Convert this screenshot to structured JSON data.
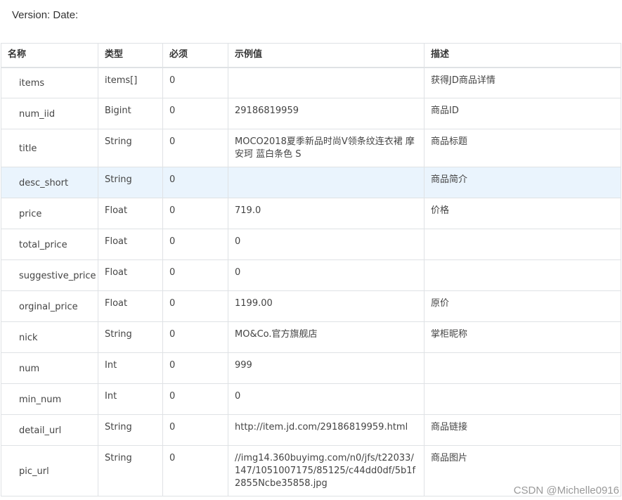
{
  "header": {
    "version_line": "Version: Date:"
  },
  "table": {
    "columns": [
      "名称",
      "类型",
      "必须",
      "示例值",
      "描述"
    ],
    "rows": [
      {
        "name": "items",
        "type": "items[]",
        "required": "0",
        "example": "",
        "desc": "获得JD商品详情"
      },
      {
        "name": "num_iid",
        "type": "Bigint",
        "required": "0",
        "example": "29186819959",
        "desc": "商品ID"
      },
      {
        "name": "title",
        "type": "String",
        "required": "0",
        "example": "MOCO2018夏季新品时尚V领条纹连衣裙 摩安珂 蓝白条色 S",
        "desc": "商品标题"
      },
      {
        "name": "desc_short",
        "type": "String",
        "required": "0",
        "example": "",
        "desc": "商品简介"
      },
      {
        "name": "price",
        "type": "Float",
        "required": "0",
        "example": "719.0",
        "desc": "价格"
      },
      {
        "name": "total_price",
        "type": "Float",
        "required": "0",
        "example": "0",
        "desc": ""
      },
      {
        "name": "suggestive_price",
        "type": "Float",
        "required": "0",
        "example": "0",
        "desc": ""
      },
      {
        "name": "orginal_price",
        "type": "Float",
        "required": "0",
        "example": "1199.00",
        "desc": "原价"
      },
      {
        "name": "nick",
        "type": "String",
        "required": "0",
        "example": "MO&Co.官方旗舰店",
        "desc": "掌柜昵称"
      },
      {
        "name": "num",
        "type": "Int",
        "required": "0",
        "example": "999",
        "desc": ""
      },
      {
        "name": "min_num",
        "type": "Int",
        "required": "0",
        "example": "0",
        "desc": ""
      },
      {
        "name": "detail_url",
        "type": "String",
        "required": "0",
        "example": "http://item.jd.com/29186819959.html",
        "desc": "商品链接"
      },
      {
        "name": "pic_url",
        "type": "String",
        "required": "0",
        "example": "//img14.360buyimg.com/n0/jfs/t22033/147/1051007175/85125/c44dd0df/5b1f2855Ncbe35858.jpg",
        "desc": "商品图片"
      }
    ]
  },
  "watermark": "CSDN @Michelle0916"
}
